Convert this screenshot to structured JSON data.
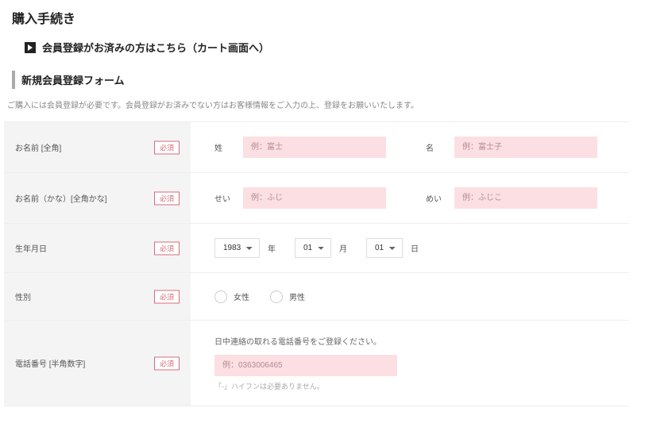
{
  "page": {
    "title": "購入手続き",
    "login_link": "会員登録がお済みの方はこちら（カート画面へ）",
    "section_title": "新規会員登録フォーム",
    "section_desc": "ご購入には会員登録が必要です。会員登録がお済みでない方はお客様情報をご入力の上、登録をお願いいたします。"
  },
  "labels": {
    "required": "必須"
  },
  "fields": {
    "name": {
      "label": "お名前 [全角]",
      "sei": "姓",
      "mei": "名",
      "sei_placeholder": "例：富士",
      "mei_placeholder": "例：富士子"
    },
    "kana": {
      "label": "お名前（かな）[全角かな]",
      "sei": "せい",
      "mei": "めい",
      "sei_placeholder": "例：ふじ",
      "mei_placeholder": "例：ふじこ"
    },
    "birth": {
      "label": "生年月日",
      "year": "1983",
      "month": "01",
      "day": "01",
      "year_unit": "年",
      "month_unit": "月",
      "day_unit": "日"
    },
    "gender": {
      "label": "性別",
      "female": "女性",
      "male": "男性"
    },
    "phone": {
      "label": "電話番号 [半角数字]",
      "note": "日中連絡の取れる電話番号をご登録ください。",
      "placeholder": "例：0363006465",
      "hint": "「-」ハイフンは必要ありません。"
    }
  }
}
